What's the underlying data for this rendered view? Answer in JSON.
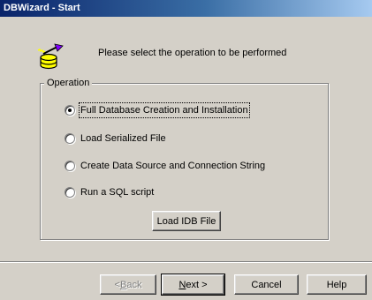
{
  "window": {
    "title": "DBWizard - Start"
  },
  "prompt": "Please select the operation to be performed",
  "operation_group": {
    "label": "Operation",
    "options": [
      {
        "label": "Full Database Creation and Installation",
        "checked": true
      },
      {
        "label": "Load Serialized File",
        "checked": false
      },
      {
        "label": "Create Data Source and Connection String",
        "checked": false
      },
      {
        "label": "Run a SQL script",
        "checked": false
      }
    ],
    "load_idb_button": "Load IDB File"
  },
  "footer": {
    "back": {
      "mnemonic": "B",
      "rest": "ack",
      "prefix": "< "
    },
    "next": {
      "mnemonic": "N",
      "rest": "ext >"
    },
    "cancel": "Cancel",
    "help": "Help"
  },
  "icon": {
    "name": "database-wizard-icon",
    "colors": {
      "cylinder": "#ffff00",
      "wand": "#8000ff"
    }
  }
}
